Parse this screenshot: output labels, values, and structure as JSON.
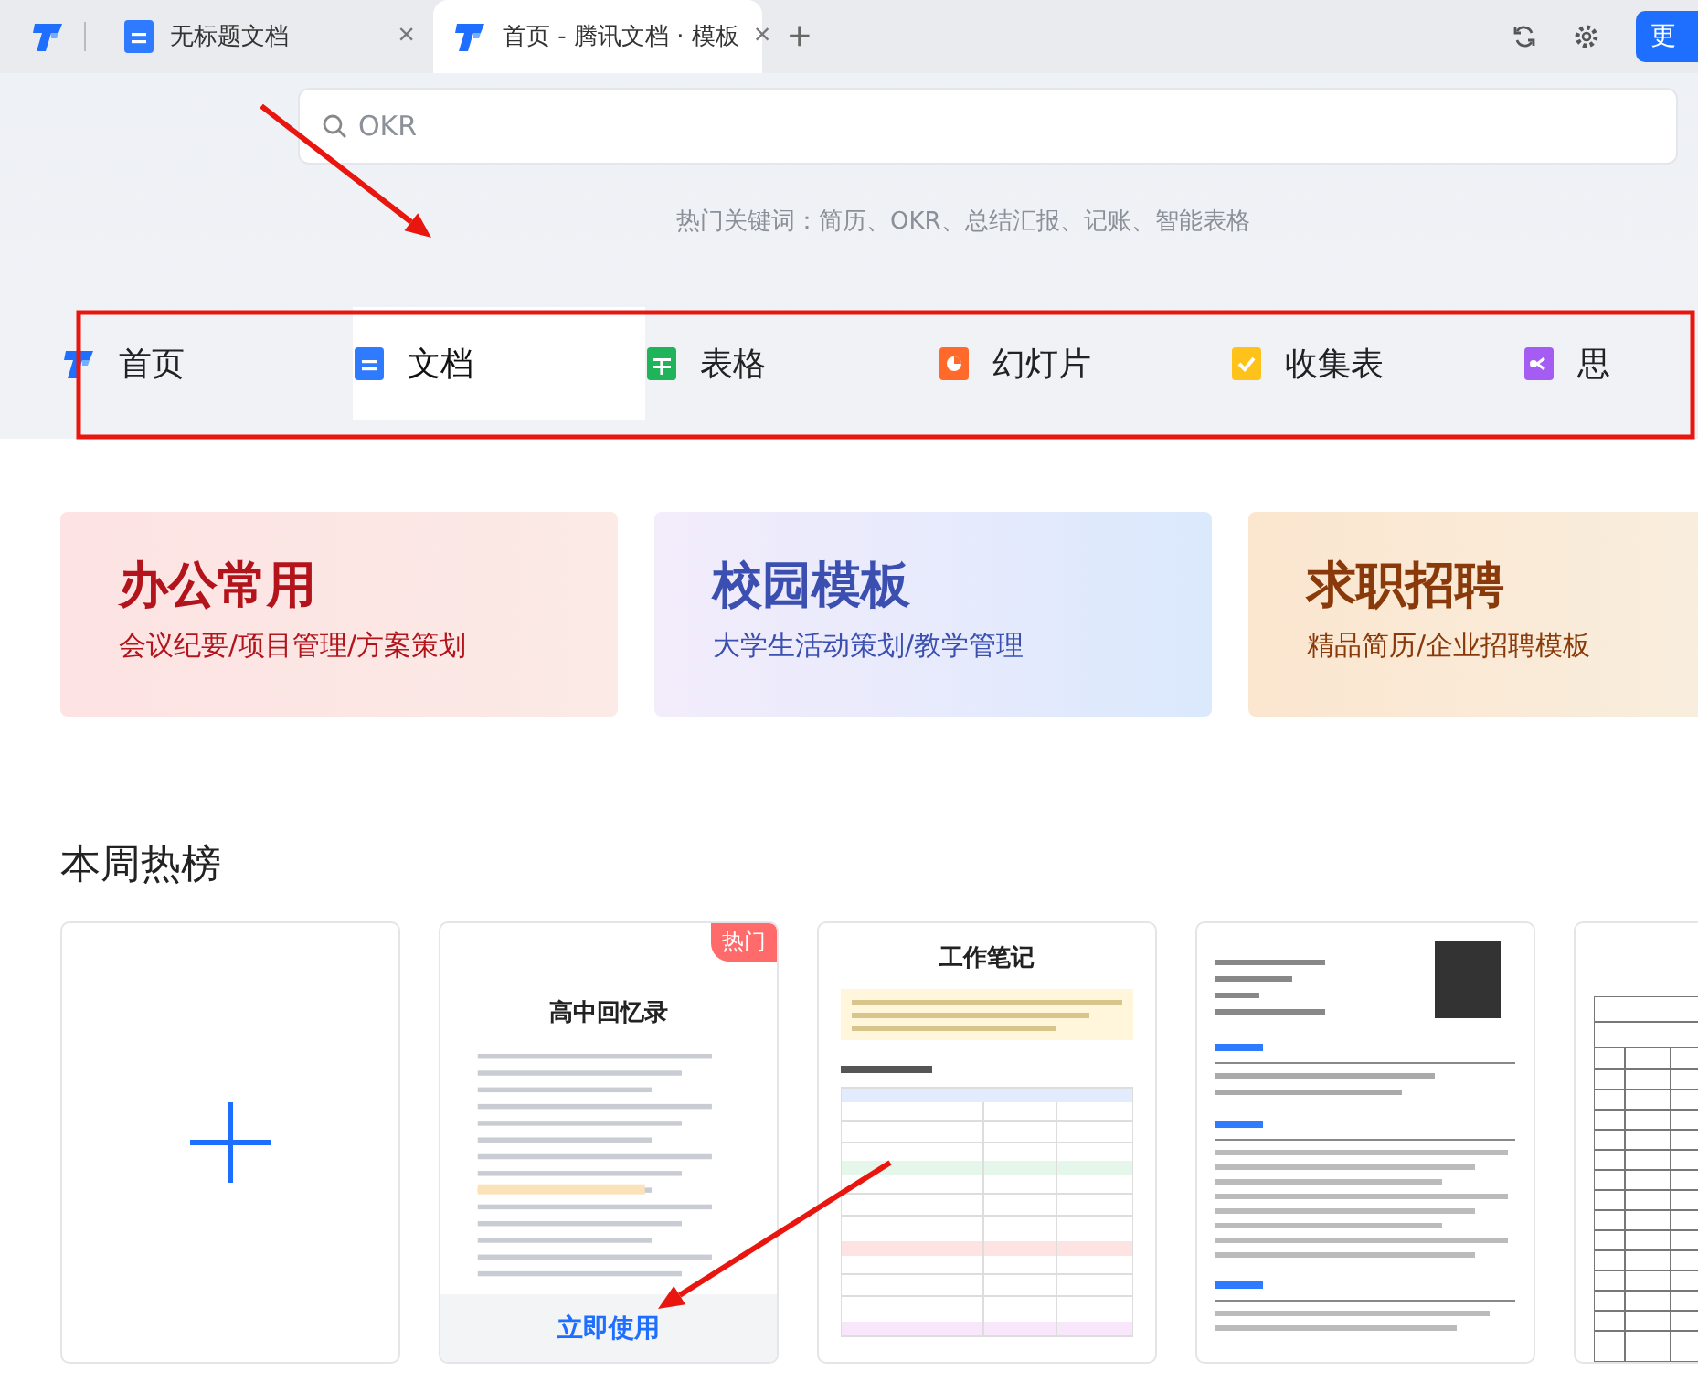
{
  "browser_tabs": [
    {
      "title": "无标题文档",
      "kind": "doc",
      "close": "×",
      "selected": false
    },
    {
      "title": "首页 - 腾讯文档 · 模板",
      "kind": "logo",
      "close": "×",
      "selected": true
    }
  ],
  "new_tab": "+",
  "toolbar": {
    "button": "更"
  },
  "search": {
    "placeholder": "OKR"
  },
  "hot_keywords": "热门关键词：简历、OKR、总结汇报、记账、智能表格",
  "categories": [
    {
      "label": "首页",
      "kind": "logo",
      "selected": false
    },
    {
      "label": "文档",
      "kind": "doc",
      "selected": true
    },
    {
      "label": "表格",
      "kind": "sheet",
      "selected": false
    },
    {
      "label": "幻灯片",
      "kind": "slides",
      "selected": false
    },
    {
      "label": "收集表",
      "kind": "form",
      "selected": false
    },
    {
      "label": "思",
      "kind": "mind",
      "selected": false
    }
  ],
  "banners": [
    {
      "title": "办公常用",
      "subtitle": "会议纪要/项目管理/方案策划",
      "kind": "office",
      "color": "#b3141c"
    },
    {
      "title": "校园模板",
      "subtitle": "大学生活动策划/教学管理",
      "kind": "campus",
      "color": "#3b4fb0"
    },
    {
      "title": "求职招聘",
      "subtitle": "精品简历/企业招聘模板",
      "kind": "jobs",
      "color": "#8a3a0a"
    }
  ],
  "weekly_hot": {
    "title": "本周热榜",
    "templates": [
      {
        "kind": "new"
      },
      {
        "kind": "memoir",
        "title": "高中回忆录",
        "badge": "热门",
        "action": "立即使用"
      },
      {
        "kind": "notes",
        "title": "工作笔记"
      },
      {
        "kind": "resume"
      },
      {
        "kind": "sheet"
      }
    ]
  },
  "annotations": [
    {
      "kind": "arrow"
    },
    {
      "kind": "frame"
    },
    {
      "kind": "arrow"
    }
  ]
}
